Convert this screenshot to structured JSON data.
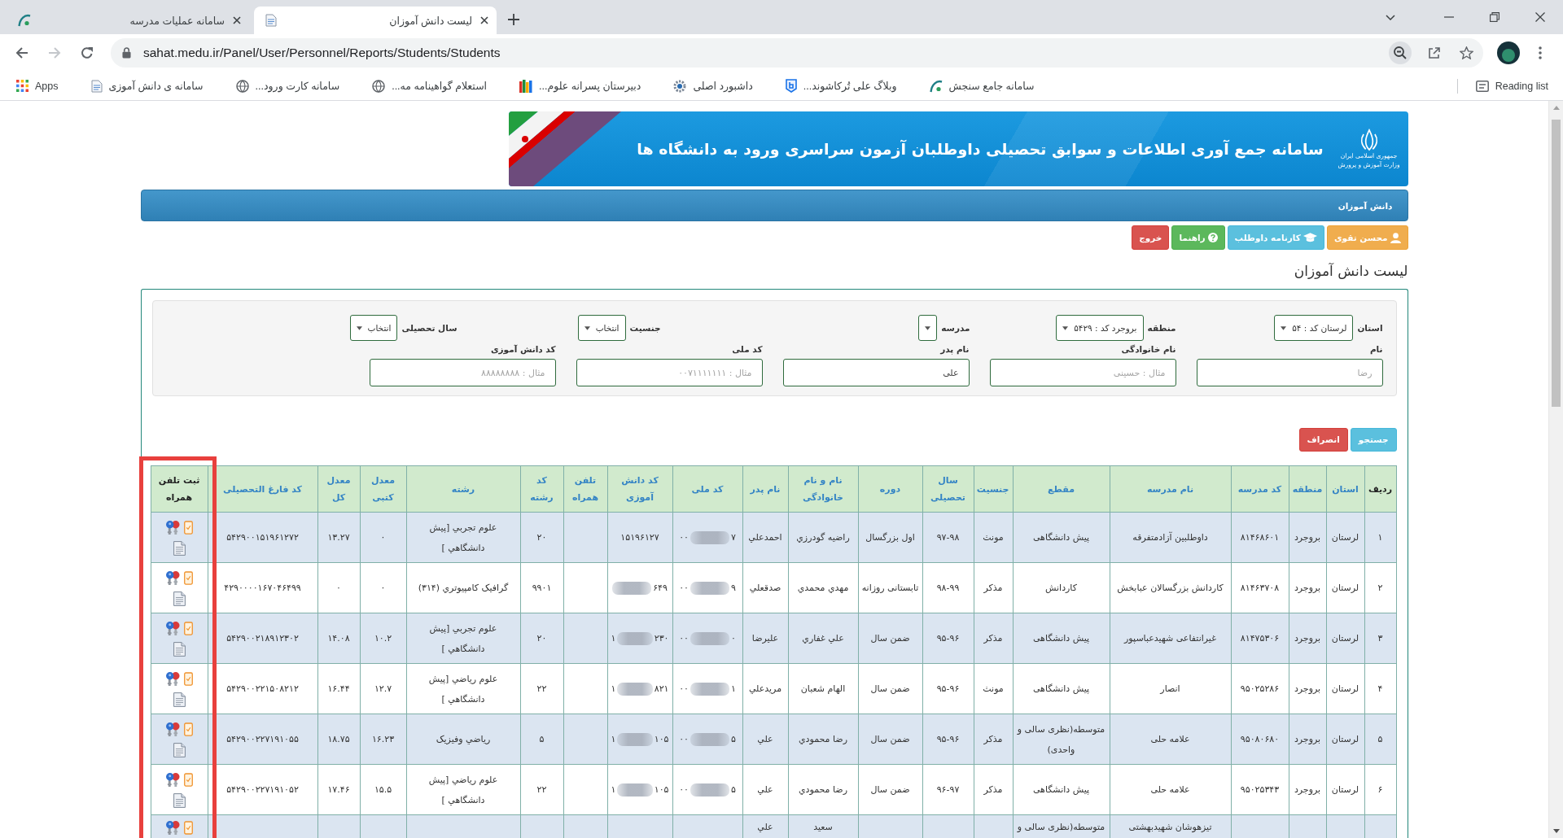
{
  "browser": {
    "tabs": [
      {
        "title": "لیست دانش آموزان",
        "selected": true
      },
      {
        "title": "سامانه عملیات مدرسه",
        "selected": false
      }
    ],
    "navigation": {
      "back_enabled": true,
      "forward_enabled": false
    },
    "url": "sahat.medu.ir/Panel/User/Personnel/Reports/Students/Students",
    "bookmarks": [
      "سامانه جامع سنجش",
      "وبلاگ علی تُرکاشوند...",
      "داشبورد اصلی",
      "دبیرستان پسرانه علوم...",
      "استعلام گواهینامه مه...",
      "سامانه کارت ورود...",
      "سامانه ی دانش آموزی",
      "Apps"
    ],
    "reading_list": "Reading list"
  },
  "banner": {
    "title": "سامانه جمع آوری اطلاعات و سوابق تحصیلی داوطلبان آزمون سراسری ورود به دانشگاه ها",
    "emblem_caption": [
      "جمهوری اسلامی ایران",
      "وزارت آموزش و پرورش"
    ]
  },
  "section_title": "دانش آموزان",
  "user_buttons": [
    {
      "label": "محسن تقوی",
      "kind": "user"
    },
    {
      "label": "کارنامه داوطلب",
      "kind": "report"
    },
    {
      "label": "راهنما",
      "kind": "help"
    },
    {
      "label": "خروج",
      "kind": "exit"
    }
  ],
  "page_title": "لیست دانش آموزان",
  "filters": {
    "selects": [
      {
        "label": "استان",
        "value": "لرستان کد : ۵۴"
      },
      {
        "label": "منطقه",
        "value": "بروجرد کد : ۵۴۲۹"
      },
      {
        "label": "مدرسه"
      },
      {
        "label": "جنسیت",
        "value": "انتخاب"
      },
      {
        "label": "سال تحصیلی",
        "value": "انتخاب"
      }
    ],
    "inputs": [
      {
        "label": "نام",
        "placeholder": "رضا"
      },
      {
        "label": "نام خانوادگی",
        "placeholder": "مثال : حسینی"
      },
      {
        "label": "نام پدر",
        "value": "علی"
      },
      {
        "label": "کد ملی",
        "placeholder": "مثال : ۰۰۷۱۱۱۱۱۱۱"
      },
      {
        "label": "کد دانش آموزی",
        "placeholder": "مثال : ۸۸۸۸۸۸۸۸"
      }
    ]
  },
  "actions": [
    {
      "label": "جستجو",
      "kind": "search"
    },
    {
      "label": "انصراف",
      "kind": "cancel"
    }
  ],
  "table": {
    "columns": [
      {
        "label": "ردیف",
        "kind": "text",
        "sortable": false,
        "highlighted": false
      },
      {
        "label": "استان",
        "kind": "text",
        "sortable": true,
        "highlighted": false
      },
      {
        "label": "منطقه",
        "kind": "text",
        "sortable": true,
        "highlighted": false
      },
      {
        "label": "کد مدرسه",
        "kind": "text",
        "sortable": true,
        "highlighted": false
      },
      {
        "label": "نام مدرسه",
        "kind": "text",
        "sortable": true,
        "highlighted": false
      },
      {
        "label": "مقطع",
        "kind": "text",
        "sortable": true,
        "highlighted": false
      },
      {
        "label": "جنسیت",
        "kind": "text",
        "sortable": true,
        "highlighted": false
      },
      {
        "label": "سال تحصیلی",
        "kind": "text",
        "sortable": true,
        "highlighted": false
      },
      {
        "label": "دوره",
        "kind": "text",
        "sortable": true,
        "highlighted": false
      },
      {
        "label": "نام و نام خانوادگی",
        "kind": "text",
        "sortable": true,
        "highlighted": false
      },
      {
        "label": "نام پدر",
        "kind": "text",
        "sortable": true,
        "highlighted": false
      },
      {
        "label": "کد ملی",
        "kind": "masked",
        "sortable": true,
        "highlighted": false
      },
      {
        "label": "کد دانش آموزی",
        "kind": "masked",
        "sortable": true,
        "highlighted": false
      },
      {
        "label": "تلفن همراه",
        "kind": "text",
        "sortable": true,
        "highlighted": false
      },
      {
        "label": "کد رشته",
        "kind": "text",
        "sortable": true,
        "highlighted": false
      },
      {
        "label": "رشته",
        "kind": "text",
        "sortable": true,
        "highlighted": false
      },
      {
        "label": "معدل کتبی",
        "kind": "text",
        "sortable": true,
        "highlighted": false
      },
      {
        "label": "معدل کل",
        "kind": "text",
        "sortable": true,
        "highlighted": false
      },
      {
        "label": "کد فارغ التحصیلی",
        "kind": "text",
        "sortable": true,
        "highlighted": false
      },
      {
        "label": "ثبت تلفن همراه",
        "kind": "actions",
        "sortable": false,
        "highlighted": true
      }
    ],
    "rows": [
      {
        "cut": false,
        "cells": [
          "۱",
          "لرستان",
          "بروجرد",
          "۸۱۴۶۸۶۰۱",
          "داوطلبین آزادمتفرقه",
          "پیش دانشگاهی",
          "مونث",
          "۹۷-۹۸",
          "اول بزرگسال",
          "راضیه گودرزي",
          "احمدعلي",
          [
            {
              "kind": "text",
              "text": "۰۰"
            },
            {
              "kind": "blur"
            },
            {
              "kind": "text",
              "text": "۷"
            }
          ],
          [
            {
              "kind": "text",
              "text": "۱۵۱۹۶۱۲۷"
            }
          ],
          null,
          "۲۰",
          "علوم تجربي [پيش دانشگاهي ]",
          "۰",
          "۱۳.۲۷",
          "۵۴۲۹۰۰۱۵۱۹۶۱۲۷۲",
          null
        ]
      },
      {
        "cut": false,
        "cells": [
          "۲",
          "لرستان",
          "بروجرد",
          "۸۱۴۶۳۷۰۸",
          "کاردانش بزرگسالان عبابخش",
          "کاردانش",
          "مذکر",
          "۹۸-۹۹",
          "تابستانی روزانه",
          "مهدي محمدي",
          "صدقعلي",
          [
            {
              "kind": "text",
              "text": "۰۰"
            },
            {
              "kind": "blur"
            },
            {
              "kind": "text",
              "text": "۹"
            }
          ],
          [
            {
              "kind": "blur"
            },
            {
              "kind": "text",
              "text": "۶۴۹"
            }
          ],
          null,
          "۹۹۰۱",
          "گرافیک کامپیوتري (۳۱۴)",
          "۰",
          "۰",
          "۴۲۹۰۰۰۰۱۶۷۰۴۶۴۹۹",
          null
        ]
      },
      {
        "cut": false,
        "cells": [
          "۳",
          "لرستان",
          "بروجرد",
          "۸۱۴۷۵۳۰۶",
          "غیرانتفاعی شهیدعباسپور",
          "پیش دانشگاهی",
          "مذکر",
          "۹۵-۹۶",
          "ضمن سال",
          "علي غفاري",
          "عليرضا",
          [
            {
              "kind": "text",
              "text": "۰۰"
            },
            {
              "kind": "blur"
            },
            {
              "kind": "text",
              "text": "۰"
            }
          ],
          [
            {
              "kind": "text",
              "text": "۱"
            },
            {
              "kind": "blur"
            },
            {
              "kind": "text",
              "text": "۲۳۰"
            }
          ],
          null,
          "۲۰",
          "علوم تجربي [پيش دانشگاهي ]",
          "۱۰.۲",
          "۱۴.۰۸",
          "۵۴۲۹۰۰۲۱۸۹۱۲۳۰۲",
          null
        ]
      },
      {
        "cut": false,
        "cells": [
          "۴",
          "لرستان",
          "بروجرد",
          "۹۵۰۲۵۲۸۶",
          "انصار",
          "پیش دانشگاهی",
          "مونث",
          "۹۵-۹۶",
          "ضمن سال",
          "الهام شعبان",
          "مريدعلي",
          [
            {
              "kind": "text",
              "text": "۰۰"
            },
            {
              "kind": "blur"
            },
            {
              "kind": "text",
              "text": "۱"
            }
          ],
          [
            {
              "kind": "text",
              "text": "۱"
            },
            {
              "kind": "blur"
            },
            {
              "kind": "text",
              "text": "۸۲۱"
            }
          ],
          null,
          "۲۲",
          "علوم رياضي [پيش دانشگاهي ]",
          "۱۲.۷",
          "۱۶.۴۴",
          "۵۴۲۹۰۰۲۲۱۵۰۸۲۱۲",
          null
        ]
      },
      {
        "cut": false,
        "cells": [
          "۵",
          "لرستان",
          "بروجرد",
          "۹۵۰۸۰۶۸۰",
          "علامه حلی",
          "متوسطه(نظری سالی و واحدی)",
          "مذکر",
          "۹۵-۹۶",
          "ضمن سال",
          "رضا محمودي",
          "علي",
          [
            {
              "kind": "text",
              "text": "۰۰"
            },
            {
              "kind": "blur"
            },
            {
              "kind": "text",
              "text": "۵"
            }
          ],
          [
            {
              "kind": "text",
              "text": "۱"
            },
            {
              "kind": "blur"
            },
            {
              "kind": "text",
              "text": "۱۰۵"
            }
          ],
          null,
          "۵",
          "رياضي وفيزيک",
          "۱۶.۲۳",
          "۱۸.۷۵",
          "۵۴۲۹۰۰۲۲۷۱۹۱۰۵۵",
          null
        ]
      },
      {
        "cut": false,
        "cells": [
          "۶",
          "لرستان",
          "بروجرد",
          "۹۵۰۲۵۳۴۳",
          "علامه حلی",
          "پیش دانشگاهی",
          "مذکر",
          "۹۶-۹۷",
          "ضمن سال",
          "رضا محمودي",
          "علي",
          [
            {
              "kind": "text",
              "text": "۰۰"
            },
            {
              "kind": "blur"
            },
            {
              "kind": "text",
              "text": "۵"
            }
          ],
          [
            {
              "kind": "text",
              "text": "۱"
            },
            {
              "kind": "blur"
            },
            {
              "kind": "text",
              "text": "۱۰۵"
            }
          ],
          null,
          "۲۲",
          "علوم رياضي [پيش دانشگاهي ]",
          "۱۵.۵",
          "۱۷.۴۶",
          "۵۴۲۹۰۰۲۲۷۱۹۱۰۵۲",
          null
        ]
      },
      {
        "cut": true,
        "cells": [
          null,
          null,
          null,
          null,
          "تیزهوشان شهیدبهشتی",
          "متوسطه(نظری سالی و",
          null,
          null,
          null,
          "سعید",
          "علي",
          null,
          null,
          null,
          null,
          null,
          null,
          null,
          null,
          null
        ]
      }
    ]
  }
}
